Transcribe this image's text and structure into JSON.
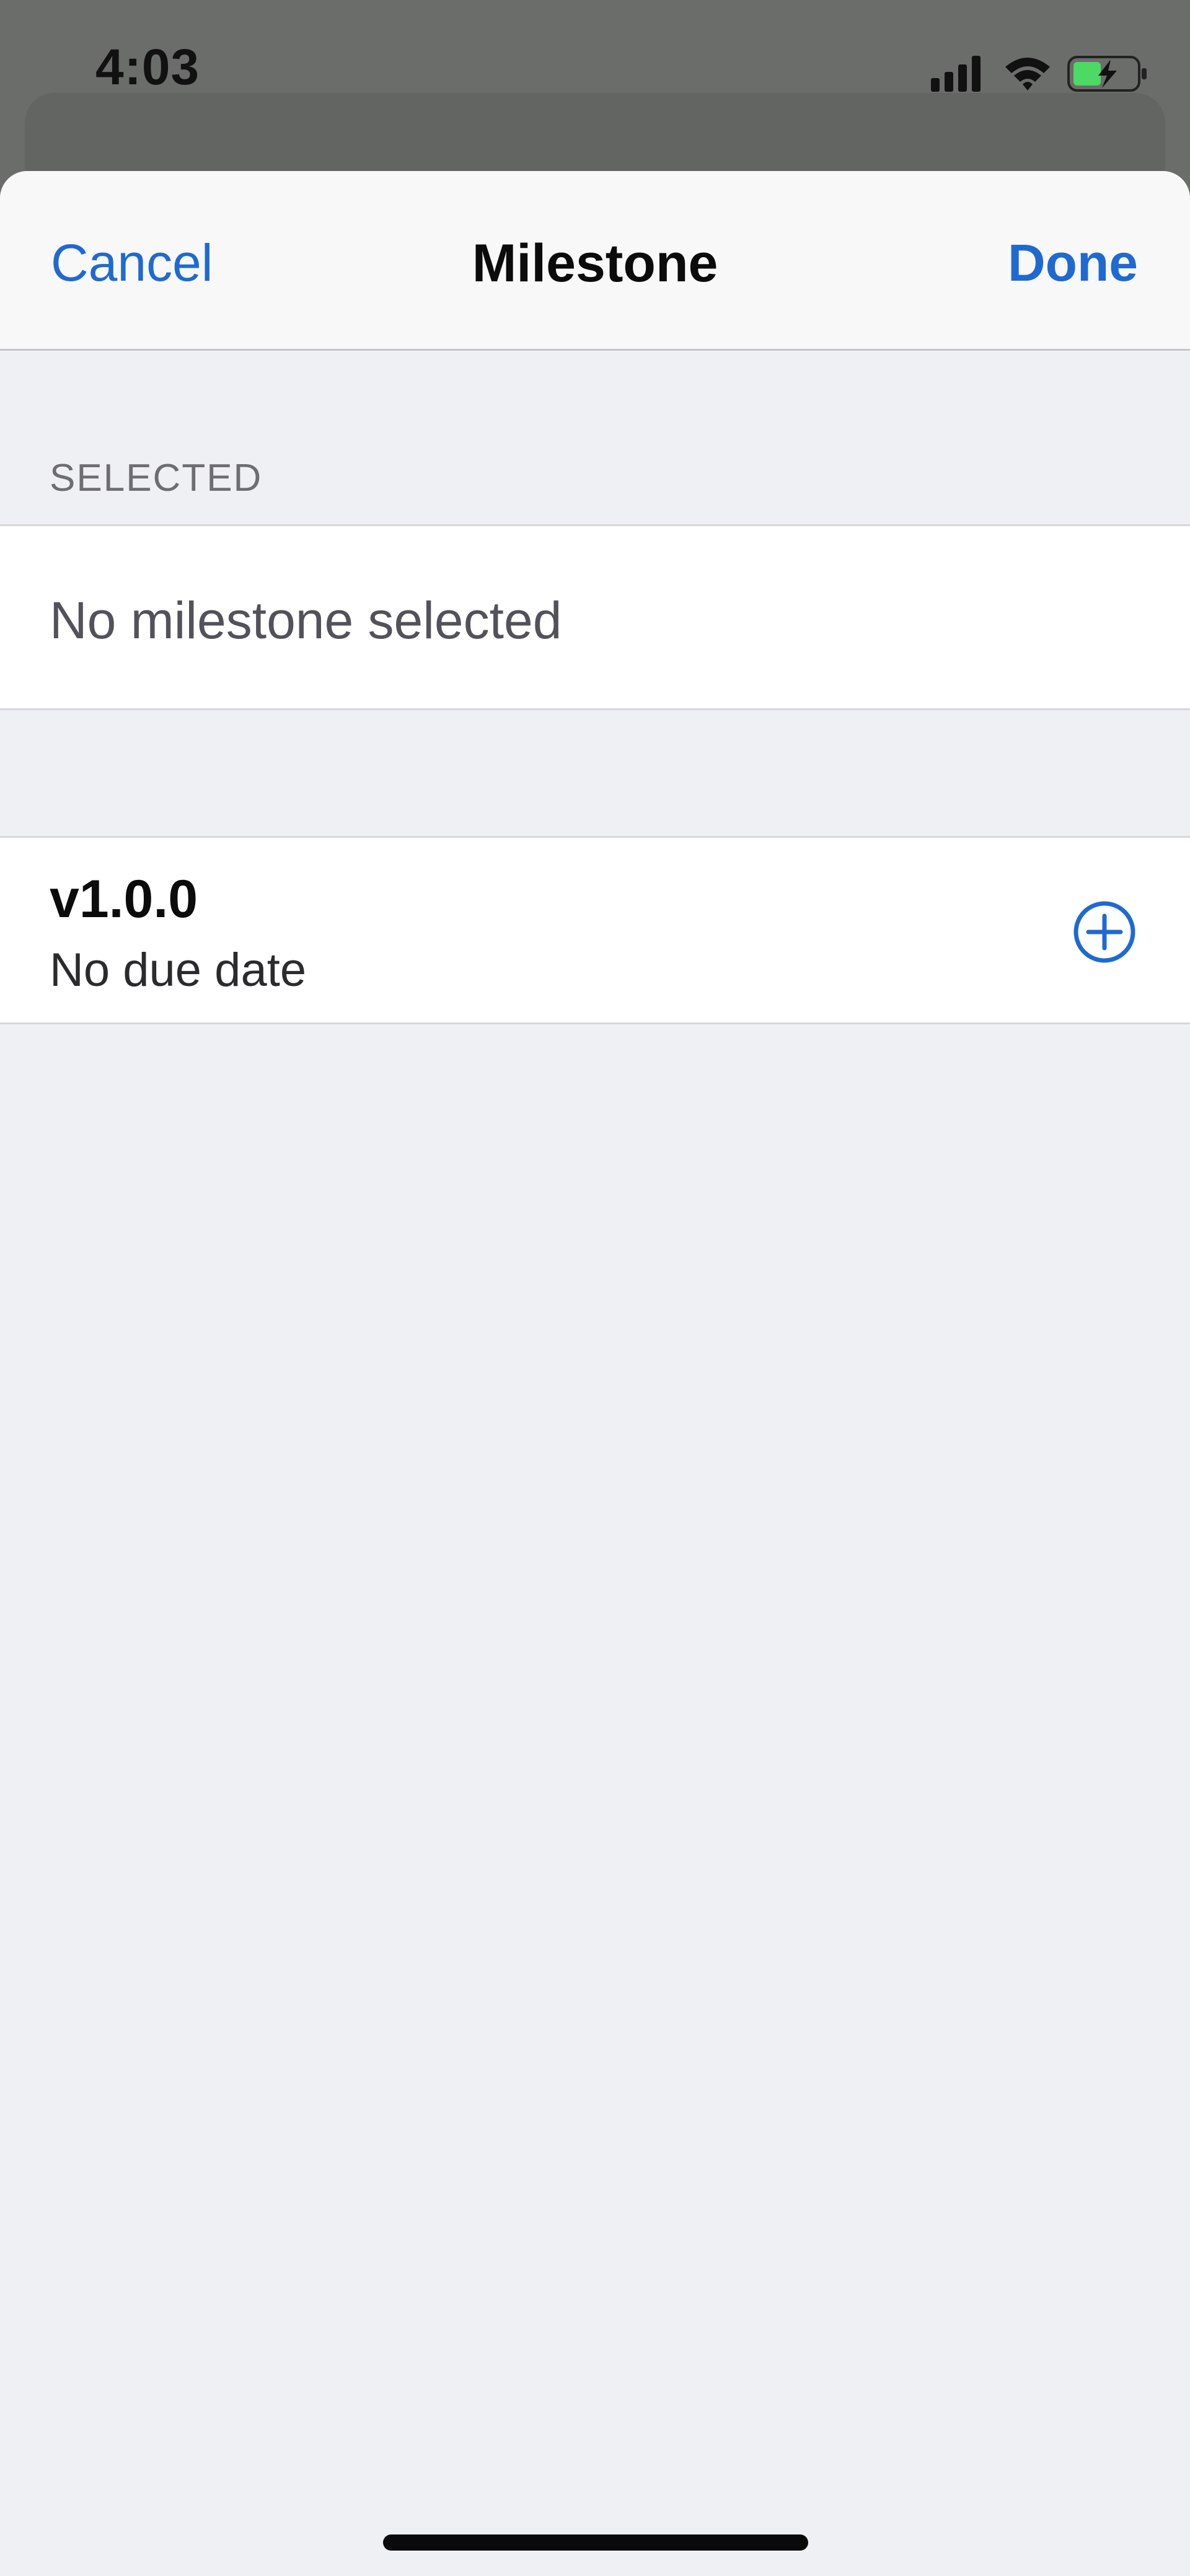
{
  "status_bar": {
    "time": "4:03",
    "icons": [
      "cellular-signal-icon",
      "wifi-icon",
      "battery-charging-icon"
    ],
    "battery_color": "#4cd964"
  },
  "nav": {
    "cancel_label": "Cancel",
    "title": "Milestone",
    "done_label": "Done"
  },
  "selected_section": {
    "header": "SELECTED",
    "empty_text": "No milestone selected"
  },
  "milestones": [
    {
      "title": "v1.0.0",
      "subtitle": "No due date",
      "action_icon": "plus-circle-icon"
    }
  ],
  "colors": {
    "accent": "#1f6ad0",
    "background": "#eff0f4",
    "dim_overlay": "#6b6d6a"
  }
}
